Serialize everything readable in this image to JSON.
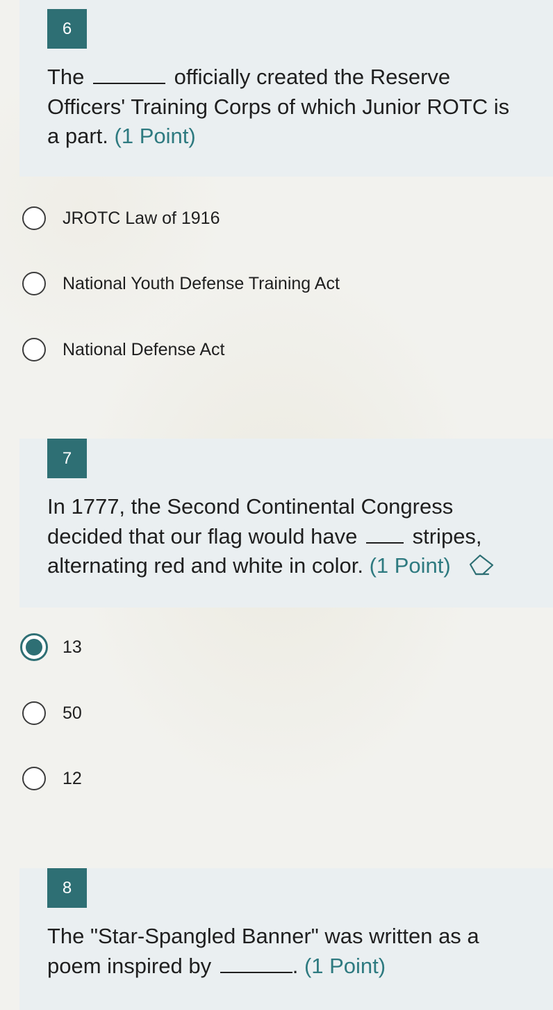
{
  "questions": [
    {
      "number": "6",
      "text_before": "The",
      "text_after": "officially created the Reserve Officers' Training Corps of which Junior ROTC is a part.",
      "points": "(1 Point)",
      "options": [
        {
          "label": "JROTC Law of 1916",
          "selected": false
        },
        {
          "label": "National Youth Defense Training Act",
          "selected": false
        },
        {
          "label": "National Defense Act",
          "selected": false
        }
      ]
    },
    {
      "number": "7",
      "text_before": "In 1777, the Second Continental Congress decided that our flag would have",
      "text_after": "stripes, alternating red and white in color.",
      "points": "(1 Point)",
      "icon": "eraser-icon",
      "options": [
        {
          "label": "13",
          "selected": true
        },
        {
          "label": "50",
          "selected": false
        },
        {
          "label": "12",
          "selected": false
        }
      ]
    },
    {
      "number": "8",
      "text_before": "The \"Star-Spangled Banner\" was written as a poem inspired by",
      "text_after": ".",
      "points": "(1 Point)"
    }
  ],
  "colors": {
    "accent": "#2e6f74",
    "points_text": "#2e7a80",
    "question_background": "#eaeff1",
    "page_background": "#f2f2ee"
  }
}
